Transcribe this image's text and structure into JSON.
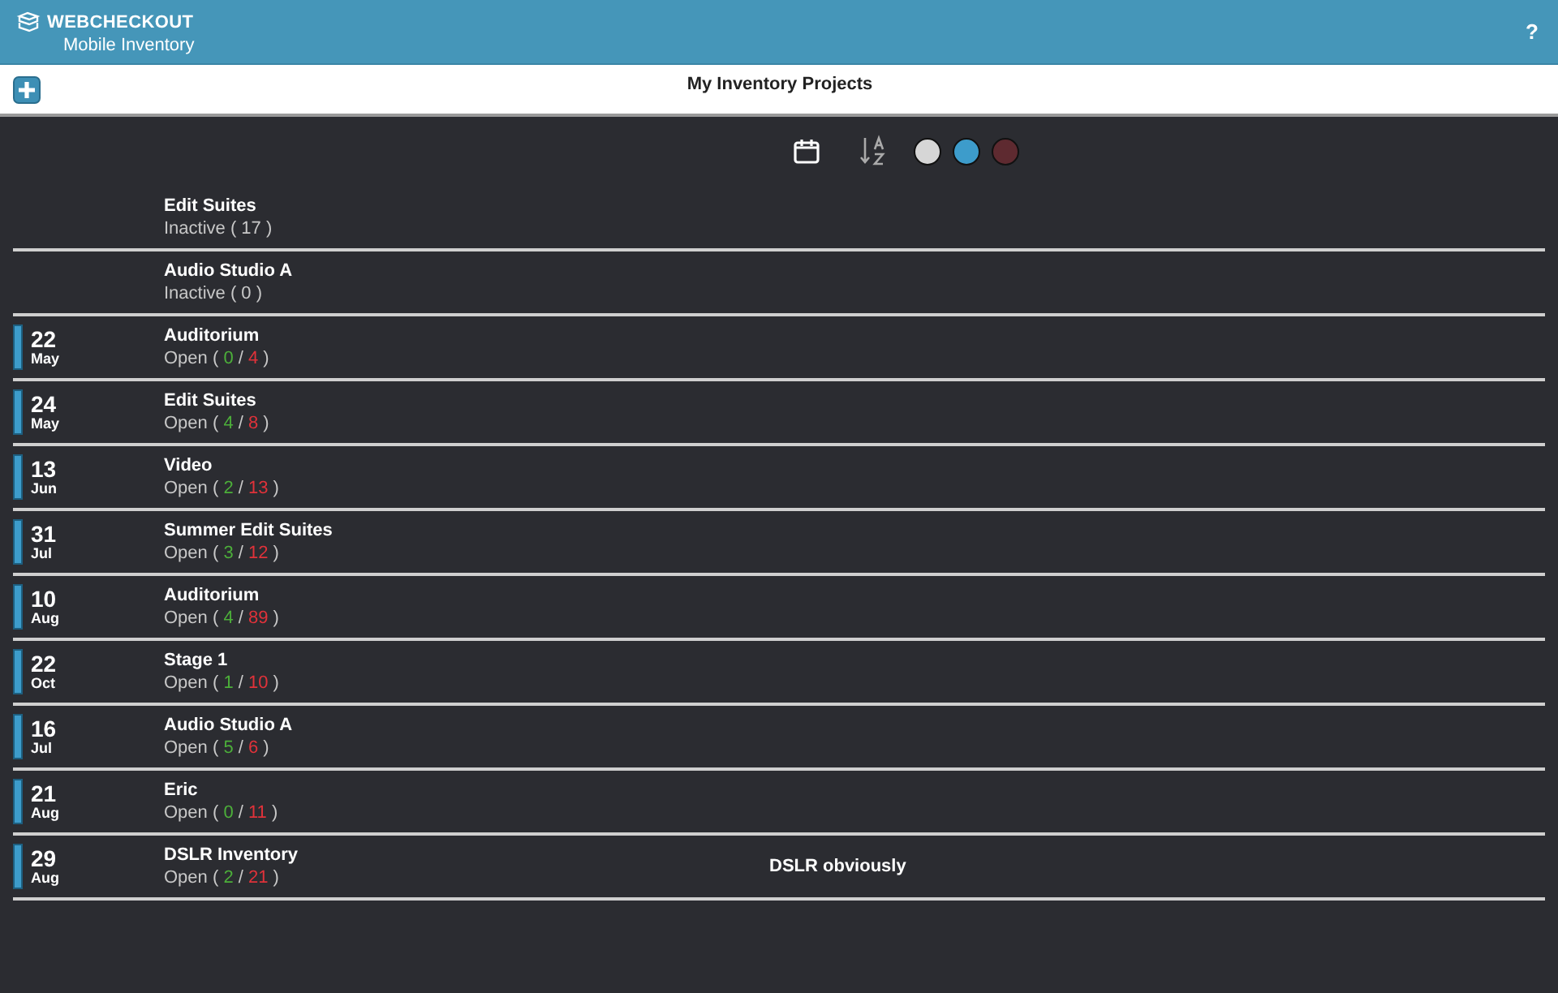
{
  "header": {
    "brand": "WEBCHECKOUT",
    "subtitle": "Mobile Inventory",
    "help": "?"
  },
  "title_bar": {
    "title": "My Inventory Projects"
  },
  "filters": [
    {
      "color": "#d6d6d6"
    },
    {
      "color": "#3d9ccb"
    },
    {
      "color": "#5e2a30"
    }
  ],
  "projects": [
    {
      "name": "Edit Suites",
      "status": [
        {
          "kind": "plain",
          "text": "Inactive ( 17 )"
        }
      ]
    },
    {
      "name": "Audio Studio A",
      "status": [
        {
          "kind": "plain",
          "text": "Inactive ( 0 )"
        }
      ]
    },
    {
      "name": "Auditorium",
      "date": {
        "day": "22",
        "month": "May"
      },
      "status": [
        {
          "kind": "plain",
          "text": "Open ( "
        },
        {
          "kind": "done",
          "text": "0"
        },
        {
          "kind": "plain",
          "text": " / "
        },
        {
          "kind": "total",
          "text": "4"
        },
        {
          "kind": "plain",
          "text": " )"
        }
      ]
    },
    {
      "name": "Edit Suites",
      "date": {
        "day": "24",
        "month": "May"
      },
      "status": [
        {
          "kind": "plain",
          "text": "Open ( "
        },
        {
          "kind": "done",
          "text": "4"
        },
        {
          "kind": "plain",
          "text": " / "
        },
        {
          "kind": "total",
          "text": "8"
        },
        {
          "kind": "plain",
          "text": " )"
        }
      ]
    },
    {
      "name": "Video",
      "date": {
        "day": "13",
        "month": "Jun"
      },
      "status": [
        {
          "kind": "plain",
          "text": "Open ( "
        },
        {
          "kind": "done",
          "text": "2"
        },
        {
          "kind": "plain",
          "text": " / "
        },
        {
          "kind": "total",
          "text": "13"
        },
        {
          "kind": "plain",
          "text": " )"
        }
      ]
    },
    {
      "name": "Summer Edit Suites",
      "date": {
        "day": "31",
        "month": "Jul"
      },
      "status": [
        {
          "kind": "plain",
          "text": "Open ( "
        },
        {
          "kind": "done",
          "text": "3"
        },
        {
          "kind": "plain",
          "text": " / "
        },
        {
          "kind": "total",
          "text": "12"
        },
        {
          "kind": "plain",
          "text": " )"
        }
      ]
    },
    {
      "name": "Auditorium",
      "date": {
        "day": "10",
        "month": "Aug"
      },
      "status": [
        {
          "kind": "plain",
          "text": "Open ( "
        },
        {
          "kind": "done",
          "text": "4"
        },
        {
          "kind": "plain",
          "text": " / "
        },
        {
          "kind": "total",
          "text": "89"
        },
        {
          "kind": "plain",
          "text": " )"
        }
      ]
    },
    {
      "name": "Stage 1",
      "date": {
        "day": "22",
        "month": "Oct"
      },
      "status": [
        {
          "kind": "plain",
          "text": "Open ( "
        },
        {
          "kind": "done",
          "text": "1"
        },
        {
          "kind": "plain",
          "text": " / "
        },
        {
          "kind": "total",
          "text": "10"
        },
        {
          "kind": "plain",
          "text": " )"
        }
      ]
    },
    {
      "name": "Audio Studio A",
      "date": {
        "day": "16",
        "month": "Jul"
      },
      "status": [
        {
          "kind": "plain",
          "text": "Open ( "
        },
        {
          "kind": "done",
          "text": "5"
        },
        {
          "kind": "plain",
          "text": " / "
        },
        {
          "kind": "total",
          "text": "6"
        },
        {
          "kind": "plain",
          "text": " )"
        }
      ]
    },
    {
      "name": "Eric",
      "date": {
        "day": "21",
        "month": "Aug"
      },
      "status": [
        {
          "kind": "plain",
          "text": "Open ( "
        },
        {
          "kind": "done",
          "text": "0"
        },
        {
          "kind": "plain",
          "text": " / "
        },
        {
          "kind": "total",
          "text": "11"
        },
        {
          "kind": "plain",
          "text": " )"
        }
      ]
    },
    {
      "name": "DSLR Inventory",
      "date": {
        "day": "29",
        "month": "Aug"
      },
      "status": [
        {
          "kind": "plain",
          "text": "Open ( "
        },
        {
          "kind": "done",
          "text": "2"
        },
        {
          "kind": "plain",
          "text": " / "
        },
        {
          "kind": "total",
          "text": "21"
        },
        {
          "kind": "plain",
          "text": " )"
        }
      ],
      "note": "DSLR obviously"
    }
  ]
}
